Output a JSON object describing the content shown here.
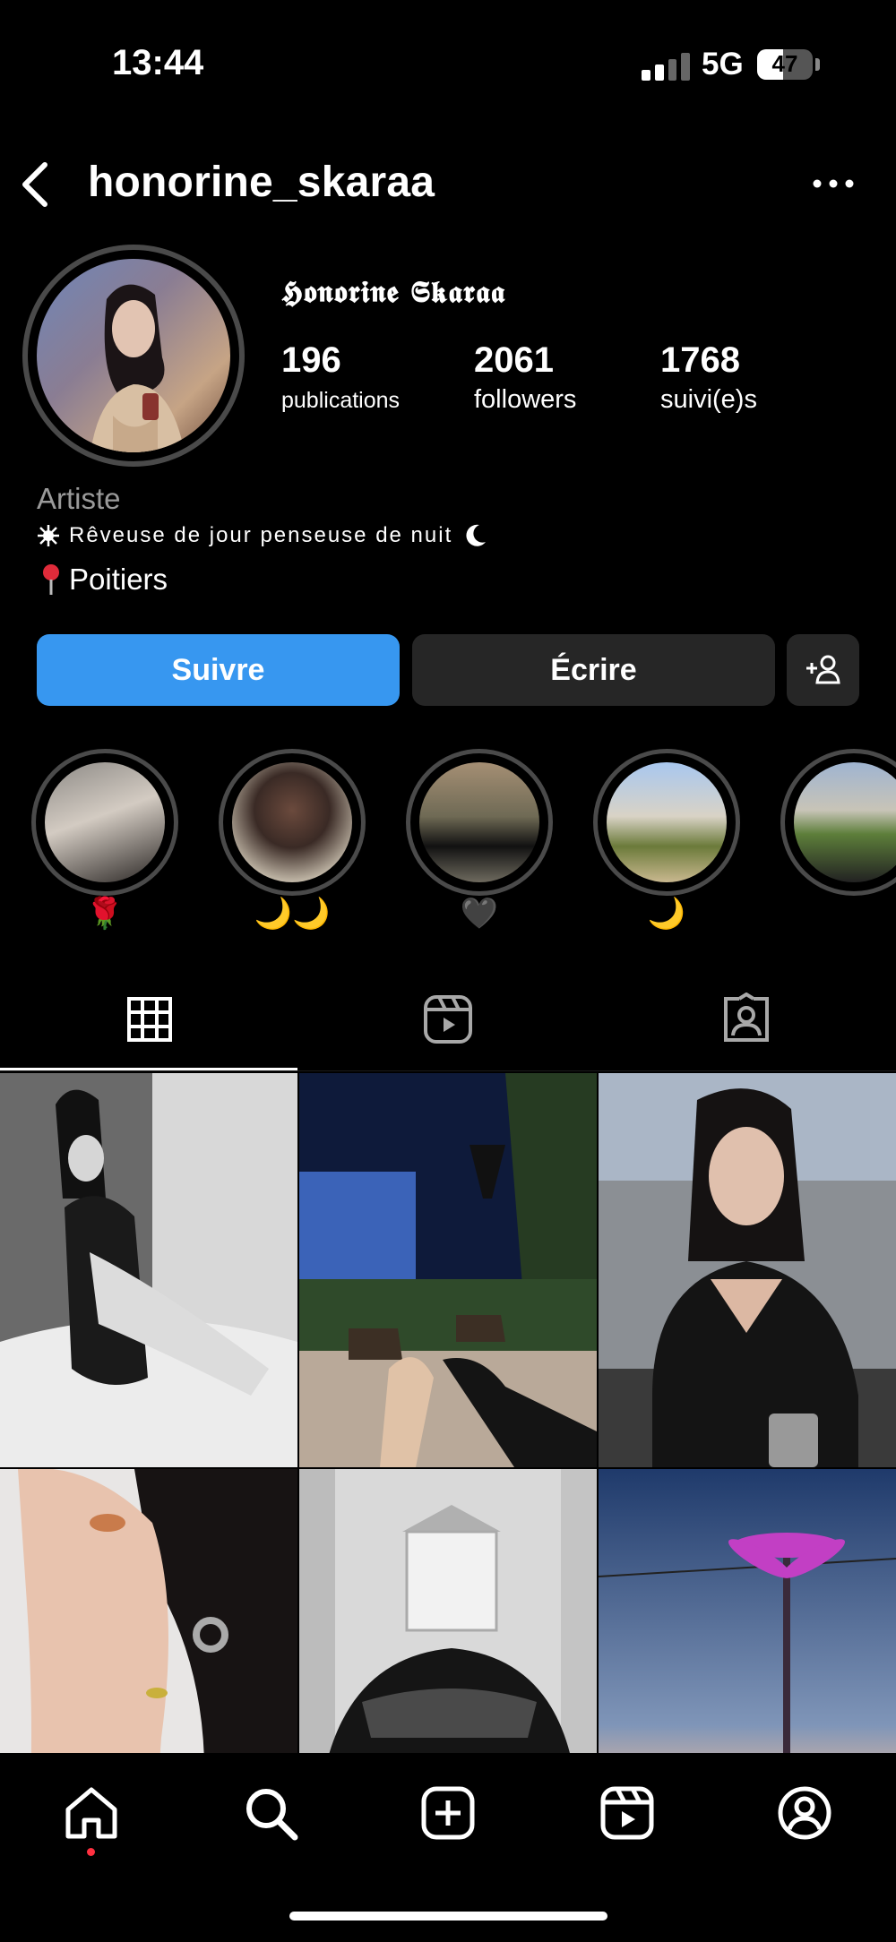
{
  "status_bar": {
    "time": "13:44",
    "network": "5G",
    "battery": "47",
    "battery_level": 0.47
  },
  "header": {
    "username": "honorine_skaraa"
  },
  "profile": {
    "display_name": "𝕳𝖔𝖓𝖔𝖗𝖎𝖓𝖊 𝕾𝖐𝖆𝖗𝖆𝖆",
    "stats": [
      {
        "value": "196",
        "label": "publications"
      },
      {
        "value": "2061",
        "label": "followers"
      },
      {
        "value": "1768",
        "label": "suivi(e)s"
      }
    ],
    "category": "Artiste",
    "bio": "Rêveuse de jour penseuse de nuit",
    "location": "Poitiers"
  },
  "actions": {
    "follow_label": "Suivre",
    "message_label": "Écrire"
  },
  "highlights": [
    {
      "label": "🌹"
    },
    {
      "label": "🌙🌙"
    },
    {
      "label": "🖤"
    },
    {
      "label": "🌙"
    },
    {
      "label": ""
    }
  ],
  "tabs": [
    "grid-icon",
    "reels-icon",
    "tagged-icon"
  ],
  "nav": [
    "home-icon",
    "search-icon",
    "create-icon",
    "reels-icon",
    "profile-icon"
  ]
}
